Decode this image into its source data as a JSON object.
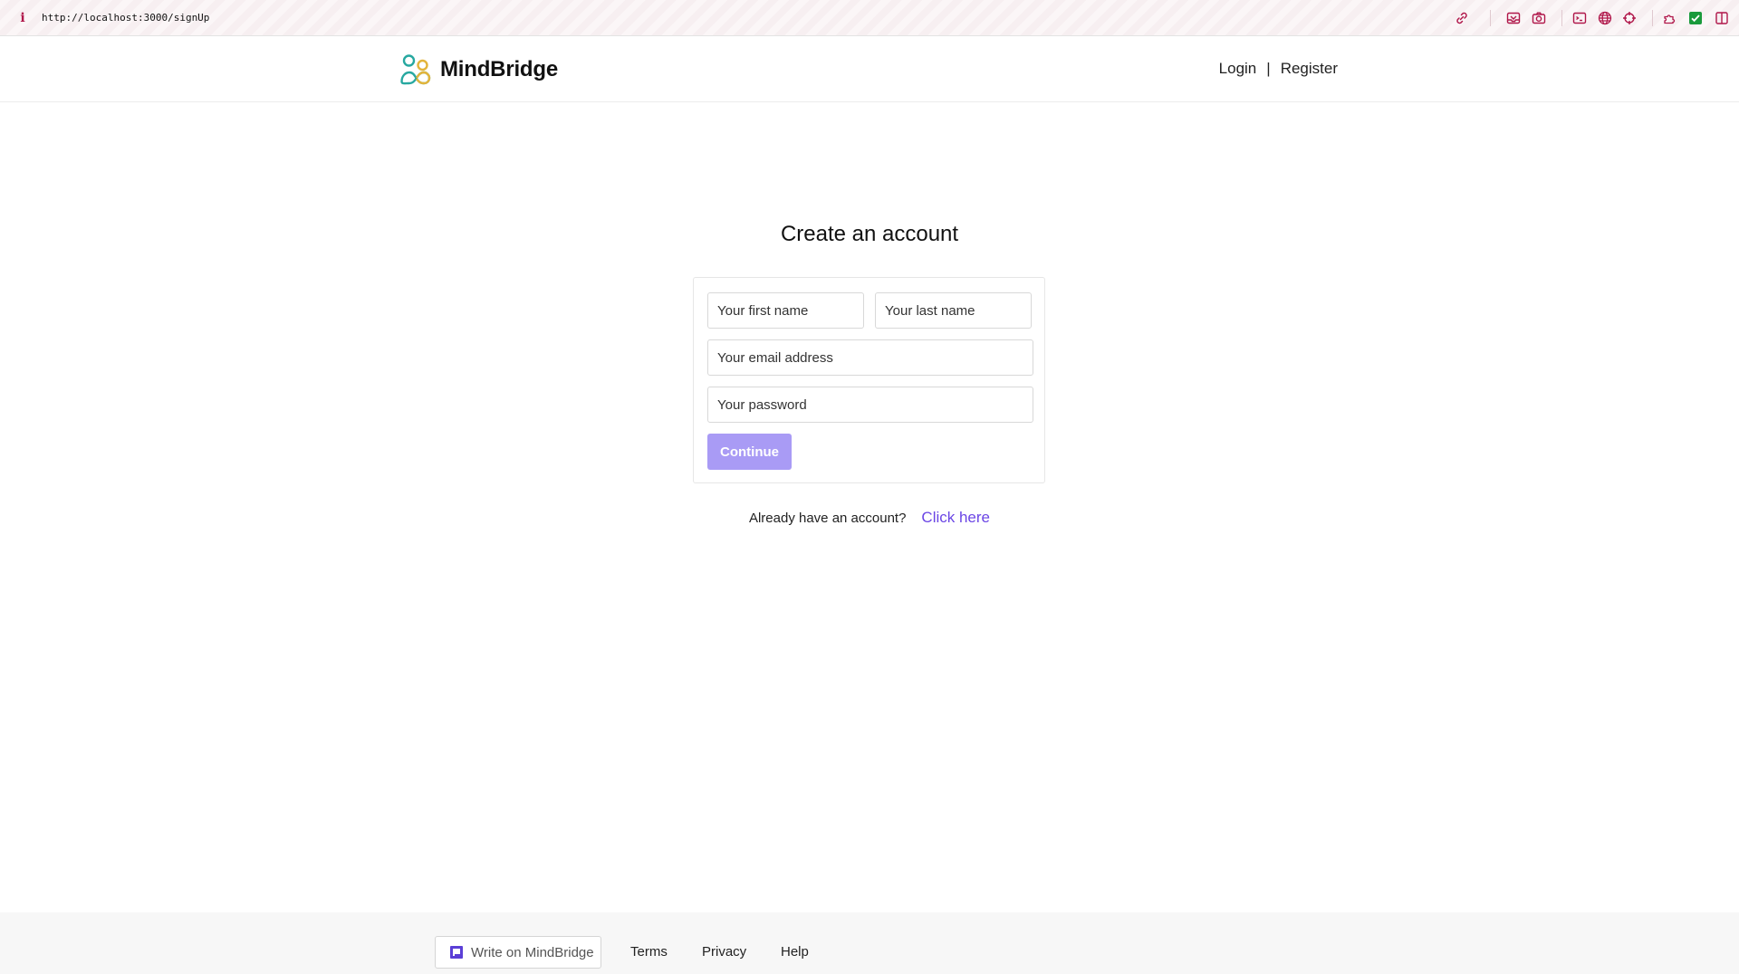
{
  "browser": {
    "url": "http://localhost:3000/signUp",
    "icons": [
      "info-icon",
      "link-icon",
      "inbox-icon",
      "camera-icon",
      "terminal-icon",
      "globe-icon",
      "crosshair-icon",
      "extension-icon",
      "checkbox-icon",
      "split-view-icon"
    ],
    "accent_color": "#b0174a"
  },
  "header": {
    "brand": "MindBridge",
    "logo_icon": "people-icon",
    "nav": {
      "login": "Login",
      "separator": "|",
      "register": "Register"
    }
  },
  "signup": {
    "title": "Create an account",
    "first_name_placeholder": "Your first name",
    "last_name_placeholder": "Your last name",
    "email_placeholder": "Your email address",
    "password_placeholder": "Your password",
    "continue_label": "Continue",
    "button_color": "#a99bf5"
  },
  "login_prompt": {
    "text": "Already have an account?",
    "link": "Click here",
    "link_color": "#6b46e5"
  },
  "footer": {
    "write_label": "Write on MindBridge",
    "terms": "Terms",
    "privacy": "Privacy",
    "help": "Help"
  }
}
